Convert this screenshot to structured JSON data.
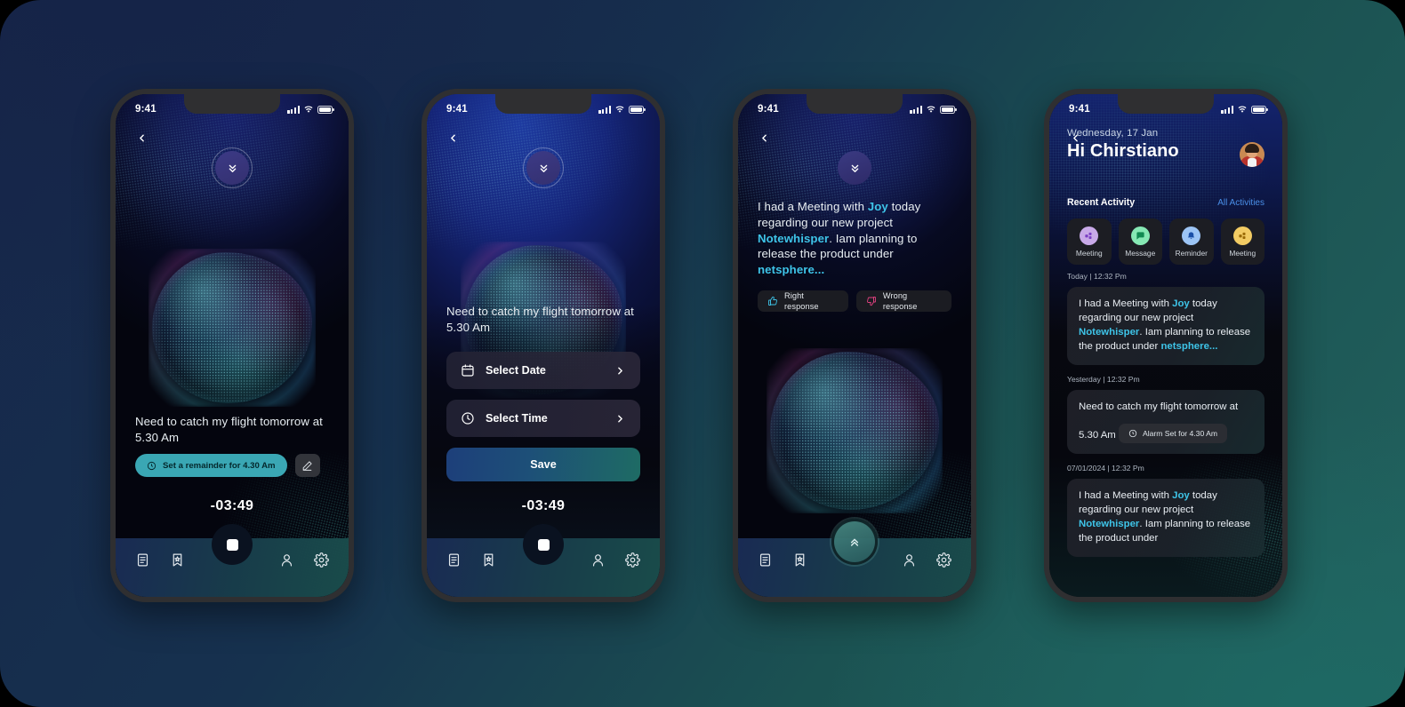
{
  "background": {
    "start_color": "#17264a",
    "end_color": "#22625e"
  },
  "status_bar": {
    "time": "9:41"
  },
  "phones": [
    {
      "id": "voice-recording",
      "back_icon": "chevron-left-icon",
      "collapse_icon": "chevrons-down-icon",
      "transcript": "Need to catch my flight tomorrow at 5.30 Am",
      "reminder_chip": {
        "label": "Set a remainder for 4.30 Am",
        "icon": "clock-icon",
        "color": "#3aa7b4"
      },
      "edit_icon": "pencil-icon",
      "timer": "-03:49",
      "record_button_icon": "stop-square-icon",
      "nav": [
        "notes-icon",
        "bookmark-star-icon",
        "person-icon",
        "gear-icon"
      ]
    },
    {
      "id": "set-reminder",
      "back_icon": "chevron-left-icon",
      "collapse_icon": "chevrons-down-icon",
      "transcript": "Need to catch my flight tomorrow at 5.30 Am",
      "rows": [
        {
          "label": "Select Date",
          "icon": "calendar-icon",
          "chevron": "chevron-right-icon"
        },
        {
          "label": "Select Time",
          "icon": "clock-icon",
          "chevron": "chevron-right-icon"
        }
      ],
      "save_label": "Save",
      "timer": "-03:49",
      "record_button_icon": "stop-square-icon",
      "nav": [
        "notes-icon",
        "bookmark-star-icon",
        "person-icon",
        "gear-icon"
      ]
    },
    {
      "id": "ai-summary",
      "back_icon": "chevron-left-icon",
      "collapse_icon": "chevrons-down-icon",
      "summary": {
        "part1": "I had a Meeting with ",
        "hl1": "Joy",
        "part2": " today regarding our new project ",
        "hl2": "Notewhisper",
        "part3": ". Iam  planning to release the product under ",
        "hl3": "netsphere..."
      },
      "feedback": [
        {
          "label": "Right response",
          "icon": "thumbs-up-icon",
          "color": "#3ec4e8"
        },
        {
          "label": "Wrong response",
          "icon": "thumbs-down-icon",
          "color": "#e0417f"
        }
      ],
      "fab_icon": "chevrons-up-icon",
      "nav": [
        "notes-icon",
        "bookmark-star-icon",
        "person-icon",
        "gear-icon"
      ]
    },
    {
      "id": "home-activity",
      "back_icon": "chevron-left-icon",
      "date": "Wednesday, 17 Jan",
      "greeting": "Hi Chirstiano",
      "avatar_name": "user-avatar",
      "section_title": "Recent Activity",
      "all_link": "All Activities",
      "categories": [
        {
          "label": "Meeting",
          "icon": "blocks-icon",
          "color": "#c8a9e8"
        },
        {
          "label": "Message",
          "icon": "chat-icon",
          "color": "#86e8b4"
        },
        {
          "label": "Reminder",
          "icon": "bell-icon",
          "color": "#9cc4f5"
        },
        {
          "label": "Meeting",
          "icon": "blocks-icon",
          "color": "#f2cb63"
        }
      ],
      "feed": [
        {
          "time": "Today | 12:32 Pm",
          "type": "summary",
          "text": {
            "part1": "I had a Meeting with ",
            "hl1": "Joy",
            "part2": " today regarding our new project ",
            "hl2": "Notewhisper",
            "part3": ". Iam  planning to release the product under ",
            "hl3": "netsphere..."
          }
        },
        {
          "time": "Yesterday | 12:32 Pm",
          "type": "reminder",
          "text": "Need to catch my flight tomorrow at 5.30 Am",
          "alarm": {
            "label": "Alarm Set for 4.30 Am",
            "icon": "clock-icon"
          }
        },
        {
          "time": "07/01/2024 | 12:32 Pm",
          "type": "summary",
          "text": {
            "part1": "I had a Meeting with ",
            "hl1": "Joy",
            "part2": " today regarding our new project ",
            "hl2": "Notewhisper",
            "part3": ". Iam  planning to release the product under ",
            "hl3": ""
          }
        }
      ]
    }
  ]
}
